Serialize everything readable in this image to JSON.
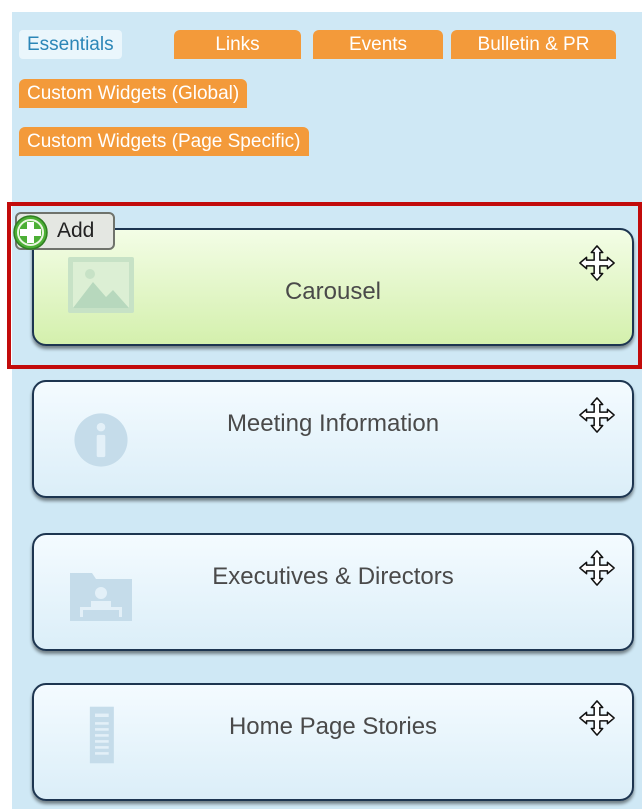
{
  "tabs": {
    "essentials": "Essentials",
    "links": "Links",
    "events": "Events",
    "bulletin": "Bulletin & PR",
    "custom_global": "Custom Widgets (Global)",
    "custom_page": "Custom Widgets (Page Specific)"
  },
  "add_button": {
    "label": "Add",
    "icon": "plus-circle-icon"
  },
  "widgets": [
    {
      "title": "Carousel",
      "icon": "image-icon",
      "selected": true
    },
    {
      "title": "Meeting Information",
      "icon": "info-icon",
      "selected": false
    },
    {
      "title": "Executives & Directors",
      "icon": "org-chart-icon",
      "selected": false
    },
    {
      "title": "Home Page Stories",
      "icon": "document-icon",
      "selected": false
    }
  ],
  "colors": {
    "panel_bg": "#cfe8f5",
    "tab_orange": "#f39a3a",
    "tab_active_text": "#2b86b7",
    "highlight": "#c20b0b",
    "add_green": "#4caf35"
  }
}
